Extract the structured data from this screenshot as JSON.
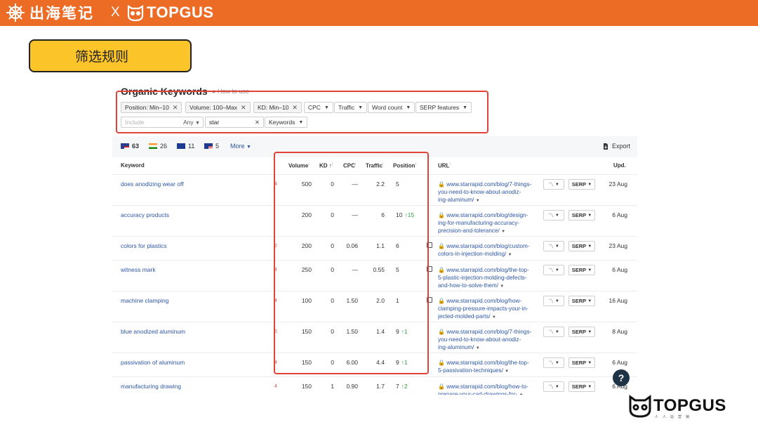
{
  "header": {
    "brand_cn": "出海笔记",
    "brand_x": "X",
    "brand_topgus": "TOPGUS",
    "accent": "#ec6b25"
  },
  "rule_label": "筛选规则",
  "panel": {
    "title": "Organic Keywords",
    "help": "How to use",
    "filters": {
      "chips": [
        {
          "label": "Position: Min–10",
          "removable": true
        },
        {
          "label": "Volume: 100–Max",
          "removable": true
        },
        {
          "label": "KD: Min–10",
          "removable": true
        },
        {
          "label": "CPC",
          "removable": false
        },
        {
          "label": "Traffic",
          "removable": false
        },
        {
          "label": "Word count",
          "removable": false
        },
        {
          "label": "SERP features",
          "removable": false
        }
      ],
      "include_placeholder": "Include",
      "any_label": "Any",
      "search_value": "star",
      "keywords_label": "Keywords"
    },
    "stats": [
      {
        "flag": "us",
        "count": "63"
      },
      {
        "flag": "in",
        "count": "26"
      },
      {
        "flag": "gb",
        "count": "11"
      },
      {
        "flag": "my",
        "count": "5"
      }
    ],
    "more": "More",
    "export": "Export",
    "columns": {
      "keyword": "Keyword",
      "volume": "Volume",
      "kd": "KD",
      "cpc": "CPC",
      "traffic": "Traffic",
      "position": "Position",
      "url": "URL",
      "upd": "Upd."
    },
    "serp_button": "SERP",
    "rows": [
      {
        "keyword": "does anodizing wear off",
        "serp": "4",
        "volume": "500",
        "kd": "0",
        "cpc": "—",
        "traffic": "2.2",
        "position": "5",
        "change": "",
        "side_icon": false,
        "url_lines": [
          "www.starrapid.com/blog/7-things-",
          "you-need-to-know-about-anodiz-",
          "ing-aluminum/"
        ],
        "updated": "23 Aug"
      },
      {
        "keyword": "accuracy products",
        "serp": "",
        "volume": "200",
        "kd": "0",
        "cpc": "—",
        "traffic": "6",
        "position": "10",
        "change": "↑15",
        "side_icon": false,
        "url_lines": [
          "www.starrapid.com/blog/design-",
          "ing-for-manufacturing-accuracy-",
          "precision-and-tolerance/"
        ],
        "updated": "6 Aug"
      },
      {
        "keyword": "colors for plastics",
        "serp": "2",
        "volume": "200",
        "kd": "0",
        "cpc": "0.06",
        "traffic": "1.1",
        "position": "6",
        "change": "",
        "side_icon": true,
        "url_lines": [
          "www.starrapid.com/blog/custom-",
          "colors-in-injection-molding/"
        ],
        "updated": "23 Aug"
      },
      {
        "keyword": "witness mark",
        "serp": "4",
        "volume": "250",
        "kd": "0",
        "cpc": "—",
        "traffic": "0.55",
        "position": "5",
        "change": "",
        "side_icon": true,
        "url_lines": [
          "www.starrapid.com/blog/the-top-",
          "5-plastic-injection-molding-defects-",
          "and-how-to-solve-them/"
        ],
        "updated": "6 Aug"
      },
      {
        "keyword": "machine clamping",
        "serp": "4",
        "volume": "100",
        "kd": "0",
        "cpc": "1.50",
        "traffic": "2.0",
        "position": "1",
        "change": "",
        "side_icon": true,
        "url_lines": [
          "www.starrapid.com/blog/how-",
          "clamping-pressure-impacts-your-in-",
          "jected-molded-parts/"
        ],
        "updated": "16 Aug"
      },
      {
        "keyword": "blue anodized aluminum",
        "serp": "5",
        "volume": "150",
        "kd": "0",
        "cpc": "1.50",
        "traffic": "1.4",
        "position": "9",
        "change": "↑1",
        "side_icon": false,
        "url_lines": [
          "www.starrapid.com/blog/7-things-",
          "you-need-to-know-about-anodiz-",
          "ing-aluminum/"
        ],
        "updated": "8 Aug"
      },
      {
        "keyword": "passivation of aluminum",
        "serp": "4",
        "volume": "150",
        "kd": "0",
        "cpc": "6.00",
        "traffic": "4.4",
        "position": "9",
        "change": "↑1",
        "side_icon": false,
        "url_lines": [
          "www.starrapid.com/blog/the-top-",
          "5-passivation-techniques/"
        ],
        "updated": "6 Aug"
      },
      {
        "keyword": "manufacturing drawing",
        "serp": "4",
        "volume": "150",
        "kd": "1",
        "cpc": "0.90",
        "traffic": "1.7",
        "position": "7",
        "change": "↑2",
        "side_icon": false,
        "url_lines": [
          "www.starrapid.com/blog/how-to-",
          "prepare-your-cad-drawings-for-"
        ],
        "updated": "6 Aug"
      }
    ]
  },
  "help_button": "?",
  "watermark": {
    "text": "TOPGUS",
    "sub": "人人站营销"
  }
}
